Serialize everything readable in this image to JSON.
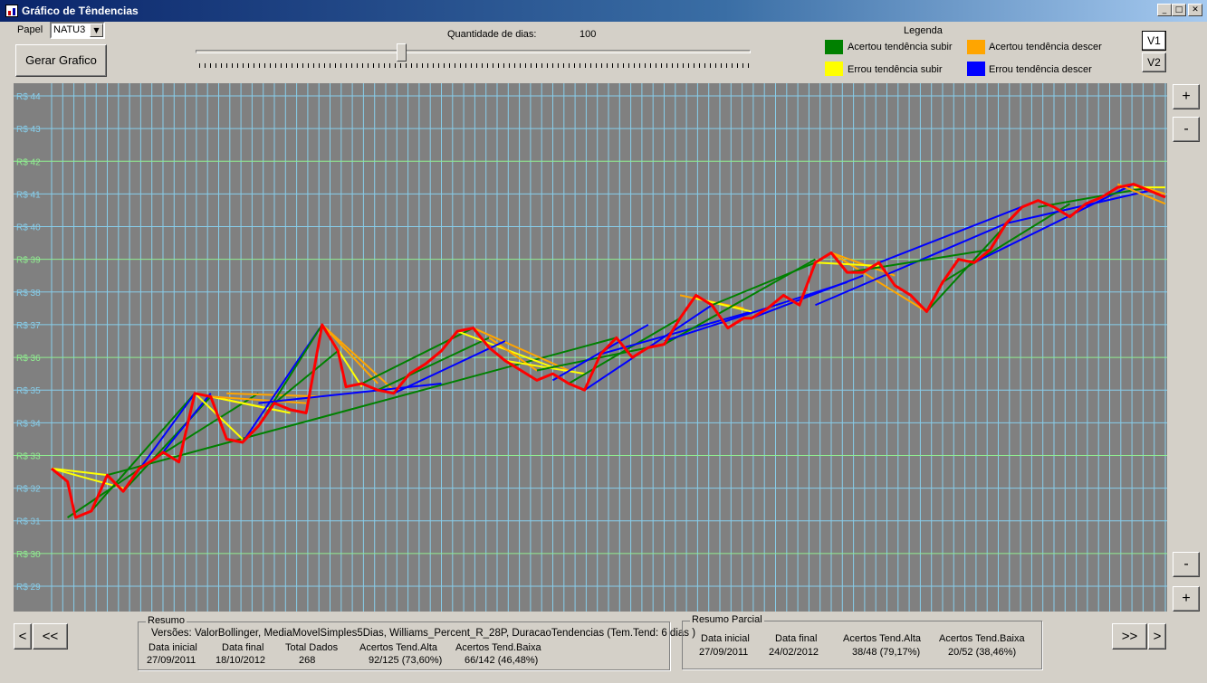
{
  "window": {
    "title": "Gráfico de Têndencias"
  },
  "controls": {
    "papel_label": "Papel",
    "papel_value": "NATU3",
    "gerar_label": "Gerar Grafico",
    "qtd_label": "Quantidade de dias:",
    "qtd_value": "100",
    "slider_fraction": 0.37,
    "v1_label": "V1",
    "v2_label": "V2",
    "zoom_in_label": "+",
    "zoom_out_label": "-",
    "prev_label": "<",
    "first_label": "<<",
    "last_label": ">>",
    "next_label": ">"
  },
  "legend": {
    "title": "Legenda",
    "items": [
      {
        "label": "Acertou tendência subir",
        "color": "#008000"
      },
      {
        "label": "Acertou tendência descer",
        "color": "#ffa500"
      },
      {
        "label": "Errou tendência subir",
        "color": "#ffff00"
      },
      {
        "label": "Errou tendência descer",
        "color": "#0000ff"
      }
    ]
  },
  "resumo": {
    "title": "Resumo",
    "versoes": "Versões: ValorBollinger, MediaMovelSimples5Dias, Williams_Percent_R_28P, DuracaoTendencias (Tem.Tend: 6 dias )",
    "headers": [
      "Data inicial",
      "Data final",
      "Total Dados",
      "Acertos Tend.Alta",
      "Acertos Tend.Baixa"
    ],
    "values": [
      "27/09/2011",
      "18/10/2012",
      "268",
      "92/125 (73,60%)",
      "66/142 (46,48%)"
    ]
  },
  "resumo_parcial": {
    "title": "Resumo Parcial",
    "headers": [
      "Data inicial",
      "Data final",
      "Acertos Tend.Alta",
      "Acertos Tend.Baixa"
    ],
    "values": [
      "27/09/2011",
      "24/02/2012",
      "38/48 (79,17%)",
      "20/52 (38,46%)"
    ]
  },
  "chart_data": {
    "type": "line",
    "y_labels": [
      "R$ 44",
      "R$ 43",
      "R$ 42",
      "R$ 41",
      "R$ 40",
      "R$ 39",
      "R$ 38",
      "R$ 37",
      "R$ 36",
      "R$ 35",
      "R$ 34",
      "R$ 33",
      "R$ 32",
      "R$ 31",
      "R$ 30",
      "R$ 29"
    ],
    "ylim": [
      29,
      44
    ],
    "grid": true,
    "colors": {
      "background": "#808080",
      "vgrid": "#87ceeb",
      "hgrid": "#90ee90",
      "price": "#ff0000"
    },
    "price_series": {
      "x": [
        0,
        2,
        3,
        5,
        7,
        9,
        11,
        13,
        14,
        16,
        18,
        20,
        22,
        24,
        26,
        28,
        30,
        32,
        34,
        36,
        37,
        39,
        41,
        43,
        45,
        47,
        49,
        51,
        53,
        55,
        57,
        59,
        61,
        63,
        65,
        67,
        69,
        71,
        73,
        75,
        77,
        79,
        81,
        83,
        85,
        87,
        88,
        90,
        92,
        94,
        96,
        98,
        100,
        102,
        104,
        106,
        108,
        110,
        112,
        114,
        116,
        118,
        120,
        122,
        124,
        126,
        128,
        130,
        132,
        134,
        136,
        138,
        140
      ],
      "y": [
        32.6,
        32.2,
        31.1,
        31.3,
        32.4,
        31.9,
        32.6,
        32.9,
        33.1,
        32.8,
        34.9,
        34.8,
        33.5,
        33.4,
        33.9,
        34.6,
        34.4,
        34.3,
        37.0,
        36.2,
        35.1,
        35.2,
        35.0,
        34.9,
        35.5,
        35.8,
        36.2,
        36.8,
        36.9,
        36.3,
        35.9,
        35.6,
        35.3,
        35.5,
        35.2,
        35.0,
        36.1,
        36.6,
        36.0,
        36.3,
        36.4,
        37.2,
        37.9,
        37.6,
        36.9,
        37.2,
        37.2,
        37.5,
        37.9,
        37.6,
        38.9,
        39.2,
        38.6,
        38.6,
        38.9,
        38.2,
        37.9,
        37.4,
        38.3,
        39.0,
        38.9,
        39.3,
        40.1,
        40.6,
        40.8,
        40.6,
        40.3,
        40.7,
        40.9,
        41.2,
        41.3,
        41.1,
        40.9
      ]
    },
    "trend_segments": [
      {
        "color": "#ffff00",
        "points": [
          [
            0,
            32.6
          ],
          [
            9,
            32.0
          ]
        ]
      },
      {
        "color": "#ffff00",
        "points": [
          [
            0,
            32.6
          ],
          [
            7,
            32.4
          ]
        ]
      },
      {
        "color": "#008000",
        "points": [
          [
            2,
            31.1
          ],
          [
            13,
            32.9
          ]
        ]
      },
      {
        "color": "#008000",
        "points": [
          [
            5,
            31.3
          ],
          [
            18,
            34.9
          ]
        ]
      },
      {
        "color": "#0000ff",
        "points": [
          [
            9,
            31.9
          ],
          [
            18,
            34.9
          ]
        ]
      },
      {
        "color": "#008000",
        "points": [
          [
            9,
            31.9
          ],
          [
            20,
            34.8
          ]
        ]
      },
      {
        "color": "#008000",
        "points": [
          [
            11,
            32.6
          ],
          [
            26,
            34.9
          ]
        ]
      },
      {
        "color": "#008000",
        "points": [
          [
            7,
            32.4
          ],
          [
            71,
            36.6
          ]
        ]
      },
      {
        "color": "#0000ff",
        "points": [
          [
            14,
            33.1
          ],
          [
            20,
            34.9
          ]
        ]
      },
      {
        "color": "#ffff00",
        "points": [
          [
            18,
            34.9
          ],
          [
            28,
            34.4
          ]
        ]
      },
      {
        "color": "#ffff00",
        "points": [
          [
            18,
            34.9
          ],
          [
            30,
            34.3
          ]
        ]
      },
      {
        "color": "#ffa500",
        "points": [
          [
            20,
            34.8
          ],
          [
            32,
            34.6
          ]
        ]
      },
      {
        "color": "#ffa500",
        "points": [
          [
            22,
            34.9
          ],
          [
            34,
            34.8
          ]
        ]
      },
      {
        "color": "#ffff00",
        "points": [
          [
            18,
            34.9
          ],
          [
            24,
            33.5
          ]
        ]
      },
      {
        "color": "#0000ff",
        "points": [
          [
            24,
            33.4
          ],
          [
            34,
            37.0
          ]
        ]
      },
      {
        "color": "#008000",
        "points": [
          [
            26,
            33.9
          ],
          [
            34,
            37.0
          ]
        ]
      },
      {
        "color": "#008000",
        "points": [
          [
            28,
            34.6
          ],
          [
            36,
            36.2
          ]
        ]
      },
      {
        "color": "#ffa500",
        "points": [
          [
            34,
            37.0
          ],
          [
            41,
            35.2
          ]
        ]
      },
      {
        "color": "#ffa500",
        "points": [
          [
            34,
            37.0
          ],
          [
            43,
            35.0
          ]
        ]
      },
      {
        "color": "#ffff00",
        "points": [
          [
            34,
            37.0
          ],
          [
            39,
            35.1
          ]
        ]
      },
      {
        "color": "#0000ff",
        "points": [
          [
            26,
            34.6
          ],
          [
            49,
            35.2
          ]
        ]
      },
      {
        "color": "#008000",
        "points": [
          [
            39,
            35.2
          ],
          [
            53,
            36.9
          ]
        ]
      },
      {
        "color": "#008000",
        "points": [
          [
            41,
            35.0
          ],
          [
            55,
            36.6
          ]
        ]
      },
      {
        "color": "#ffff00",
        "points": [
          [
            51,
            36.8
          ],
          [
            63,
            35.7
          ]
        ]
      },
      {
        "color": "#ffa500",
        "points": [
          [
            53,
            36.9
          ],
          [
            65,
            35.6
          ]
        ]
      },
      {
        "color": "#ffa500",
        "points": [
          [
            55,
            36.6
          ],
          [
            61,
            35.6
          ]
        ]
      },
      {
        "color": "#ffff00",
        "points": [
          [
            57,
            35.9
          ],
          [
            67,
            35.5
          ]
        ]
      },
      {
        "color": "#0000ff",
        "points": [
          [
            43,
            34.9
          ],
          [
            57,
            36.5
          ]
        ]
      },
      {
        "color": "#008000",
        "points": [
          [
            61,
            35.6
          ],
          [
            75,
            36.3
          ]
        ]
      },
      {
        "color": "#0000ff",
        "points": [
          [
            63,
            35.3
          ],
          [
            75,
            37.0
          ]
        ]
      },
      {
        "color": "#0000ff",
        "points": [
          [
            67,
            35.0
          ],
          [
            83,
            37.6
          ]
        ]
      },
      {
        "color": "#008000",
        "points": [
          [
            65,
            35.2
          ],
          [
            79,
            37.2
          ]
        ]
      },
      {
        "color": "#0000ff",
        "points": [
          [
            69,
            36.1
          ],
          [
            88,
            37.4
          ]
        ]
      },
      {
        "color": "#ffa500",
        "points": [
          [
            79,
            37.9
          ],
          [
            87,
            37.5
          ]
        ]
      },
      {
        "color": "#ffff00",
        "points": [
          [
            81,
            37.8
          ],
          [
            88,
            37.4
          ]
        ]
      },
      {
        "color": "#008000",
        "points": [
          [
            77,
            36.4
          ],
          [
            96,
            39.0
          ]
        ]
      },
      {
        "color": "#008000",
        "points": [
          [
            83,
            37.6
          ],
          [
            96,
            38.9
          ]
        ]
      },
      {
        "color": "#0000ff",
        "points": [
          [
            77,
            36.5
          ],
          [
            100,
            38.3
          ]
        ]
      },
      {
        "color": "#0000ff",
        "points": [
          [
            88,
            37.2
          ],
          [
            102,
            38.5
          ]
        ]
      },
      {
        "color": "#ffa500",
        "points": [
          [
            98,
            39.2
          ],
          [
            106,
            38.5
          ]
        ]
      },
      {
        "color": "#ffa500",
        "points": [
          [
            98,
            39.2
          ],
          [
            110,
            37.4
          ]
        ]
      },
      {
        "color": "#ffff00",
        "points": [
          [
            96,
            38.9
          ],
          [
            104,
            38.8
          ]
        ]
      },
      {
        "color": "#0000ff",
        "points": [
          [
            96,
            37.6
          ],
          [
            120,
            40.1
          ]
        ]
      },
      {
        "color": "#008000",
        "points": [
          [
            100,
            38.6
          ],
          [
            118,
            39.3
          ]
        ]
      },
      {
        "color": "#0000ff",
        "points": [
          [
            104,
            38.9
          ],
          [
            124,
            40.8
          ]
        ]
      },
      {
        "color": "#008000",
        "points": [
          [
            110,
            37.4
          ],
          [
            122,
            40.6
          ]
        ]
      },
      {
        "color": "#008000",
        "points": [
          [
            112,
            38.3
          ],
          [
            128,
            40.7
          ]
        ]
      },
      {
        "color": "#0000ff",
        "points": [
          [
            116,
            38.9
          ],
          [
            136,
            41.3
          ]
        ]
      },
      {
        "color": "#0000ff",
        "points": [
          [
            120,
            40.1
          ],
          [
            138,
            41.1
          ]
        ]
      },
      {
        "color": "#008000",
        "points": [
          [
            124,
            40.6
          ],
          [
            138,
            41.2
          ]
        ]
      },
      {
        "color": "#ffa500",
        "points": [
          [
            134,
            41.3
          ],
          [
            140,
            40.7
          ]
        ]
      },
      {
        "color": "#ffa500",
        "points": [
          [
            136,
            41.3
          ],
          [
            140,
            41.0
          ]
        ]
      },
      {
        "color": "#ffff00",
        "points": [
          [
            136,
            41.2
          ],
          [
            140,
            41.2
          ]
        ]
      }
    ],
    "xlim": [
      0,
      140
    ],
    "title": "",
    "xlabel": "",
    "ylabel": ""
  }
}
